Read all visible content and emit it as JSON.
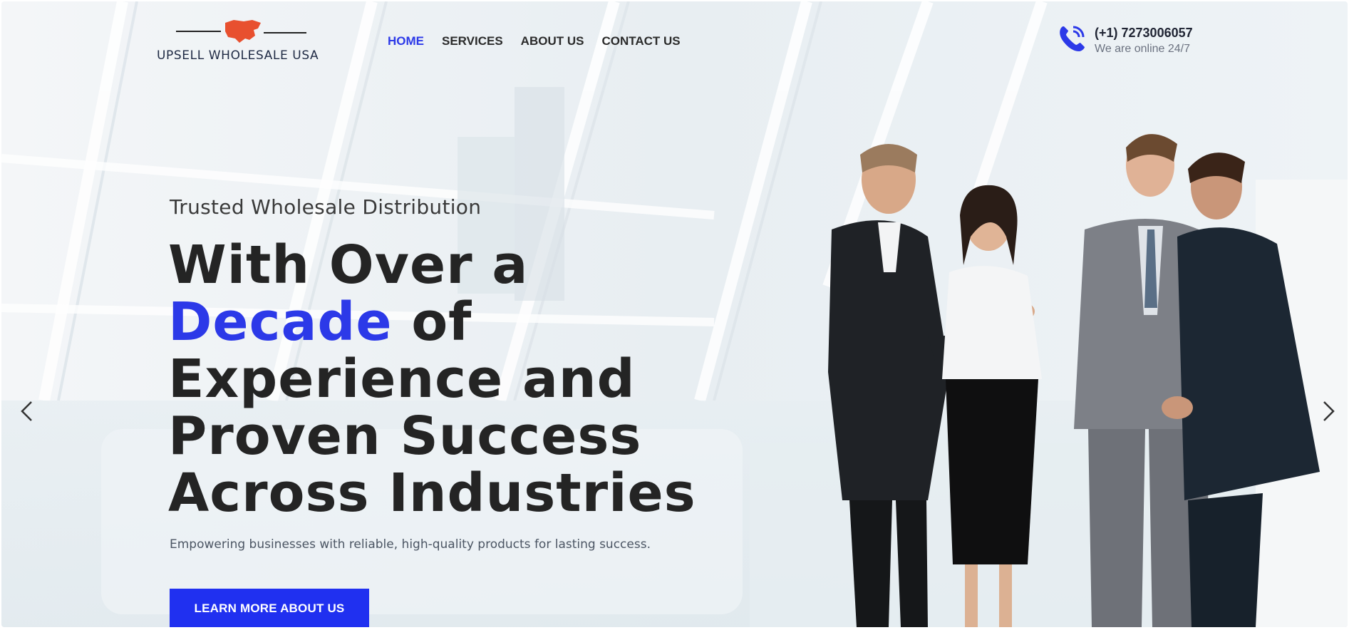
{
  "brand": {
    "name": "UPSELL WHOLESALE USA",
    "logo_icon": "usa-map-icon",
    "logo_color": "#e8502f"
  },
  "nav": {
    "items": [
      {
        "label": "HOME",
        "active": true
      },
      {
        "label": "SERVICES",
        "active": false
      },
      {
        "label": "ABOUT US",
        "active": false
      },
      {
        "label": "CONTACT US",
        "active": false
      }
    ]
  },
  "contact": {
    "icon": "phone-icon",
    "phone": "(+1) 7273006057",
    "status": "We are online 24/7"
  },
  "hero": {
    "eyebrow": "Trusted Wholesale Distribution",
    "headline_part1": "With Over a",
    "headline_accent": "Decade",
    "headline_part2": " of",
    "headline_part3": "Experience and",
    "headline_part4": "Proven Success",
    "headline_part5": "Across Industries",
    "subtitle": "Empowering businesses with reliable, high-quality products for lasting success.",
    "cta_label": "LEARN MORE ABOUT US",
    "prev_icon": "chevron-left-icon",
    "next_icon": "chevron-right-icon",
    "background_image": "business-people-meeting-photo"
  },
  "colors": {
    "accent": "#2c39e8",
    "button": "#2030f0",
    "heading": "#242424"
  }
}
